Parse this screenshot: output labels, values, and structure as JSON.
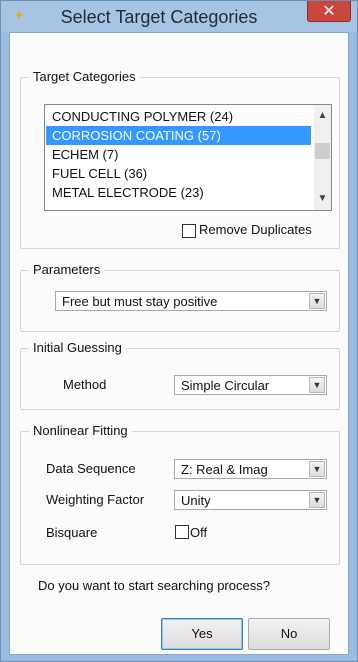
{
  "window": {
    "title": "Select Target Categories",
    "close_glyph": "✕",
    "app_icon": "pin-icon"
  },
  "target_categories": {
    "legend": "Target Categories",
    "items": [
      {
        "label": "CONDUCTING POLYMER (24)",
        "selected": false
      },
      {
        "label": "CORROSION COATING (57)",
        "selected": true
      },
      {
        "label": "ECHEM (7)",
        "selected": false
      },
      {
        "label": "FUEL CELL (36)",
        "selected": false
      },
      {
        "label": "METAL ELECTRODE (23)",
        "selected": false
      }
    ],
    "remove_duplicates_label": "Remove Duplicates",
    "remove_duplicates_checked": false
  },
  "parameters": {
    "legend": "Parameters",
    "value": "Free but must stay positive"
  },
  "initial_guessing": {
    "legend": "Initial Guessing",
    "method_label": "Method",
    "method_value": "Simple Circular"
  },
  "nonlinear_fitting": {
    "legend": "Nonlinear Fitting",
    "data_sequence_label": "Data Sequence",
    "data_sequence_value": "Z: Real & Imag",
    "weighting_label": "Weighting Factor",
    "weighting_value": "Unity",
    "bisquare_label": "Bisquare",
    "bisquare_value": "Off",
    "bisquare_checked": false
  },
  "prompt": "Do you want to start searching process?",
  "buttons": {
    "yes": "Yes",
    "no": "No"
  },
  "colors": {
    "title_bar": "#a6c5e4",
    "close_button": "#c9473d",
    "selection": "#3399ff"
  }
}
